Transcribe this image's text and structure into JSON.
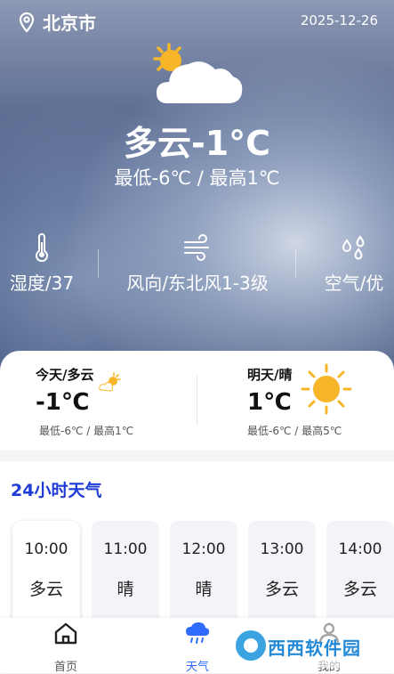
{
  "header": {
    "city": "北京市",
    "date": "2025-12-26"
  },
  "current": {
    "temp_text": "多云-1°C",
    "range_text": "最低-6℃  /  最高1℃"
  },
  "stats": [
    {
      "label": "湿度/37",
      "icon": "thermometer-icon"
    },
    {
      "label": "风向/东北风1-3级",
      "icon": "wind-icon"
    },
    {
      "label": "空气/优",
      "icon": "raindrops-icon"
    }
  ],
  "today": {
    "title": "今天/多云",
    "temp": "-1℃",
    "range": "最低-6℃ / 最高1℃",
    "icon": "partly-cloudy-icon"
  },
  "tomorrow": {
    "title": "明天/晴",
    "temp": "1℃",
    "range": "最低-6℃ / 最高5℃",
    "icon": "sun-icon"
  },
  "hourly_title": "24小时天气",
  "hourly": [
    {
      "time": "10:00",
      "weather": "多云"
    },
    {
      "time": "11:00",
      "weather": "晴"
    },
    {
      "time": "12:00",
      "weather": "晴"
    },
    {
      "time": "13:00",
      "weather": "多云"
    },
    {
      "time": "14:00",
      "weather": "多云"
    }
  ],
  "nav": [
    {
      "label": "首页",
      "icon": "home-icon"
    },
    {
      "label": "天气",
      "icon": "weather-icon"
    },
    {
      "label": "我的",
      "icon": "user-icon"
    }
  ],
  "watermark": {
    "text": "西西软件园"
  },
  "colors": {
    "accent": "#1f3bd6",
    "nav_active": "#2f6bff",
    "sun": "#f7b52a"
  }
}
